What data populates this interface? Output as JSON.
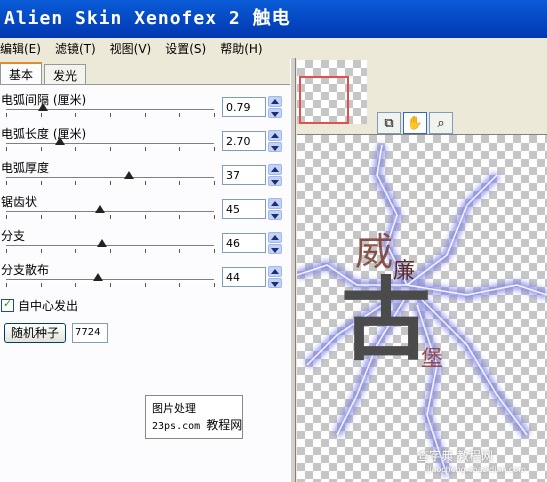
{
  "window": {
    "title": "Alien Skin Xenofex 2 触电"
  },
  "menu": [
    {
      "label": "编辑(E)"
    },
    {
      "label": "滤镜(T)"
    },
    {
      "label": "视图(V)"
    },
    {
      "label": "设置(S)"
    },
    {
      "label": "帮助(H)"
    }
  ],
  "tabs": [
    {
      "label": "基本",
      "active": true
    },
    {
      "label": "发光",
      "active": false
    }
  ],
  "params": [
    {
      "label": "电弧间隔 (厘米)",
      "value": "0.79",
      "slider_fraction": 0.18
    },
    {
      "label": "电弧长度 (厘米)",
      "value": "2.70",
      "slider_fraction": 0.26
    },
    {
      "label": "电弧厚度",
      "value": "37",
      "slider_fraction": 0.59
    },
    {
      "label": "锯齿状",
      "value": "45",
      "slider_fraction": 0.45
    },
    {
      "label": "分支",
      "value": "46",
      "slider_fraction": 0.46
    },
    {
      "label": "分支散布",
      "value": "44",
      "slider_fraction": 0.44
    }
  ],
  "checkbox": {
    "label": "自中心发出",
    "checked": true
  },
  "seed": {
    "button_label": "随机种子",
    "value": "7724"
  },
  "watermark": {
    "line1": "图片处理",
    "line2": "23ps.com",
    "line2_suffix": "教程网"
  },
  "tools": [
    {
      "icon": "preview-compare-icon"
    },
    {
      "icon": "hand-icon"
    },
    {
      "icon": "zoom-icon"
    }
  ],
  "canvas": {
    "chars": [
      "威",
      "廉",
      "古",
      "堡"
    ],
    "credit_line1": "查字典 教程网",
    "credit_line2": "jiaocheng.chazidian.com"
  },
  "colors": {
    "titlebar": "#0a5bd8",
    "lightning": "#7b7fe6",
    "selection": "#e05050"
  }
}
